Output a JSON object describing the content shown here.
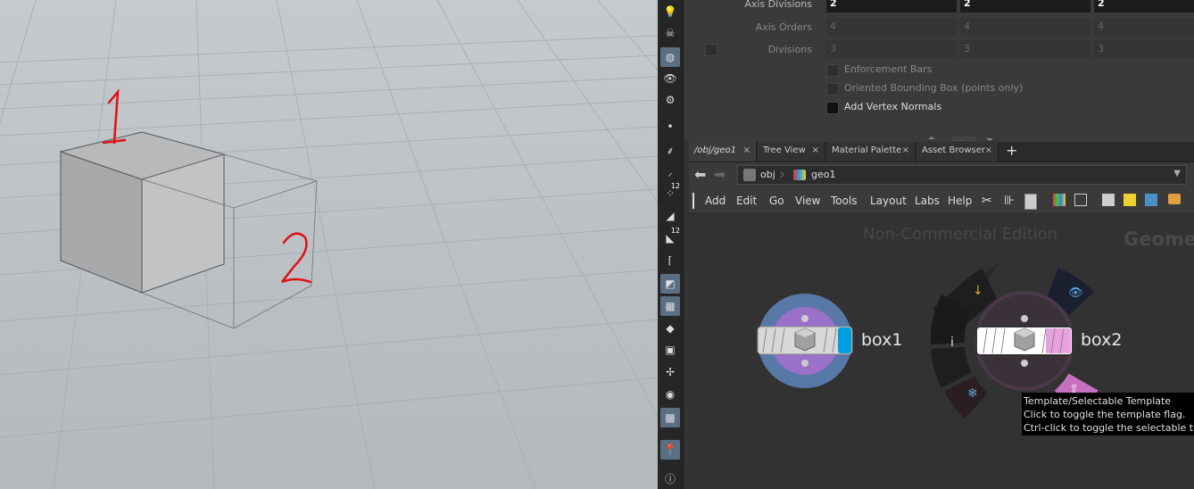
{
  "viewport": {
    "annotations": [
      "1",
      "2"
    ]
  },
  "parameters": {
    "rows": [
      {
        "label": "Axis Divisions",
        "values": [
          "2",
          "2",
          "2"
        ]
      },
      {
        "label": "Axis Orders",
        "values": [
          "4",
          "4",
          "4"
        ]
      },
      {
        "label": "Divisions",
        "values": [
          "3",
          "3",
          "3"
        ]
      }
    ],
    "checkboxes": [
      {
        "label": "Enforcement Bars",
        "checked": false
      },
      {
        "label": "Oriented Bounding Box (points only)",
        "checked": false
      },
      {
        "label": "Add Vertex Normals",
        "checked": true
      }
    ]
  },
  "tabs": [
    {
      "label": "/obj/geo1"
    },
    {
      "label": "Tree View"
    },
    {
      "label": "Material Palette"
    },
    {
      "label": "Asset Browser"
    }
  ],
  "tab_add_label": "+",
  "tab_close_label": "×",
  "path": {
    "segments": [
      "obj",
      "geo1"
    ]
  },
  "menu": [
    "Add",
    "Edit",
    "Go",
    "View",
    "Tools",
    "Layout",
    "Labs",
    "Help"
  ],
  "network": {
    "watermark": "Non-Commercial Edition",
    "context_label": "Geome",
    "nodes": [
      {
        "name": "box1"
      },
      {
        "name": "box2"
      }
    ]
  },
  "tooltip": {
    "lines": [
      "Template/Selectable Template",
      "Click to toggle the template flag.",
      "Ctrl-click to toggle the selectable template"
    ]
  },
  "colors": {
    "bypass_flag": "#00a0e0",
    "template_flag": "#e8a0e0",
    "node_ring": "#5878a8",
    "node_inner": "#9a70c8",
    "annotation": "#e01010"
  }
}
